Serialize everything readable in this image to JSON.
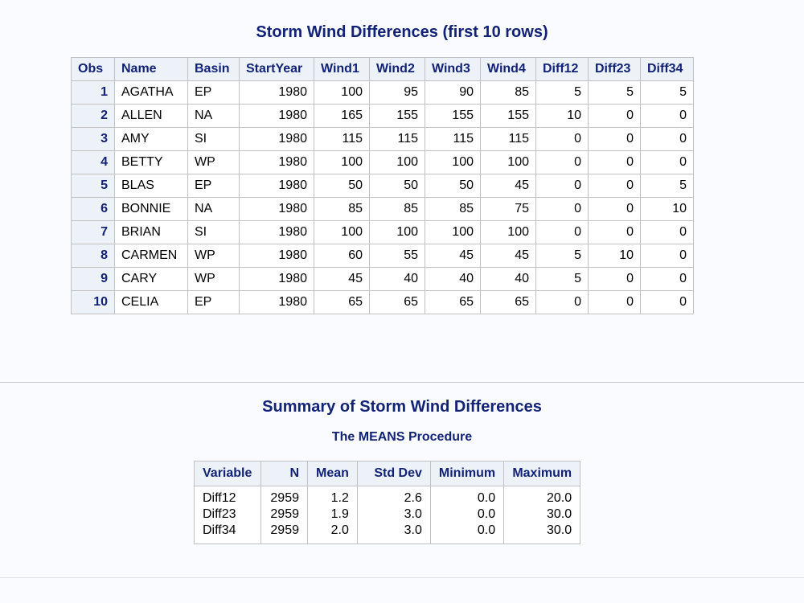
{
  "title": "Storm Wind Differences (first 10 rows)",
  "table": {
    "headers": [
      "Obs",
      "Name",
      "Basin",
      "StartYear",
      "Wind1",
      "Wind2",
      "Wind3",
      "Wind4",
      "Diff12",
      "Diff23",
      "Diff34"
    ],
    "rows": [
      [
        "1",
        "AGATHA",
        "EP",
        "1980",
        "100",
        "95",
        "90",
        "85",
        "5",
        "5",
        "5"
      ],
      [
        "2",
        "ALLEN",
        "NA",
        "1980",
        "165",
        "155",
        "155",
        "155",
        "10",
        "0",
        "0"
      ],
      [
        "3",
        "AMY",
        "SI",
        "1980",
        "115",
        "115",
        "115",
        "115",
        "0",
        "0",
        "0"
      ],
      [
        "4",
        "BETTY",
        "WP",
        "1980",
        "100",
        "100",
        "100",
        "100",
        "0",
        "0",
        "0"
      ],
      [
        "5",
        "BLAS",
        "EP",
        "1980",
        "50",
        "50",
        "50",
        "45",
        "0",
        "0",
        "5"
      ],
      [
        "6",
        "BONNIE",
        "NA",
        "1980",
        "85",
        "85",
        "85",
        "75",
        "0",
        "0",
        "10"
      ],
      [
        "7",
        "BRIAN",
        "SI",
        "1980",
        "100",
        "100",
        "100",
        "100",
        "0",
        "0",
        "0"
      ],
      [
        "8",
        "CARMEN",
        "WP",
        "1980",
        "60",
        "55",
        "45",
        "45",
        "5",
        "10",
        "0"
      ],
      [
        "9",
        "CARY",
        "WP",
        "1980",
        "45",
        "40",
        "40",
        "40",
        "5",
        "0",
        "0"
      ],
      [
        "10",
        "CELIA",
        "EP",
        "1980",
        "65",
        "65",
        "65",
        "65",
        "0",
        "0",
        "0"
      ]
    ]
  },
  "summary": {
    "title": "Summary of Storm Wind Differences",
    "subtitle": "The MEANS Procedure",
    "headers": [
      "Variable",
      "N",
      "Mean",
      "Std Dev",
      "Minimum",
      "Maximum"
    ],
    "columns": [
      [
        "Diff12",
        "Diff23",
        "Diff34"
      ],
      [
        "2959",
        "2959",
        "2959"
      ],
      [
        "1.2",
        "1.9",
        "2.0"
      ],
      [
        "2.6",
        "3.0",
        "3.0"
      ],
      [
        "0.0",
        "0.0",
        "0.0"
      ],
      [
        "20.0",
        "30.0",
        "30.0"
      ]
    ]
  }
}
